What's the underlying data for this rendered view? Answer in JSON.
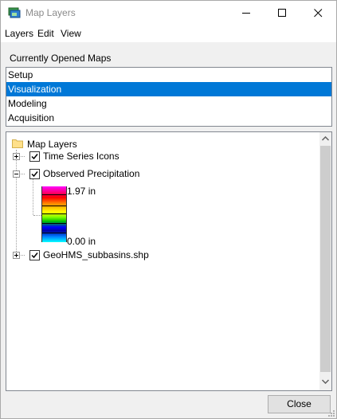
{
  "window": {
    "title": "Map Layers"
  },
  "menu": {
    "items": [
      "Layers",
      "Edit",
      "View"
    ]
  },
  "maps_section": {
    "label": "Currently Opened Maps",
    "maps": [
      {
        "label": "Setup",
        "selected": false
      },
      {
        "label": "Visualization",
        "selected": true
      },
      {
        "label": "Modeling",
        "selected": false
      },
      {
        "label": "Acquisition",
        "selected": false
      }
    ]
  },
  "tree": {
    "root_label": "Map Layers",
    "layers": [
      {
        "label": "Time Series Icons",
        "checked": true,
        "expanded": false
      },
      {
        "label": "Observed Precipitation",
        "checked": true,
        "expanded": true
      },
      {
        "label": "GeoHMS_subbasins.shp",
        "checked": true,
        "expanded": false
      }
    ],
    "legend": {
      "max_label": "1.97 in",
      "min_label": "0.00 in"
    }
  },
  "buttons": {
    "close_label": "Close"
  },
  "colors": {
    "selection": "#0078d7",
    "folder": "#ffe08a"
  }
}
